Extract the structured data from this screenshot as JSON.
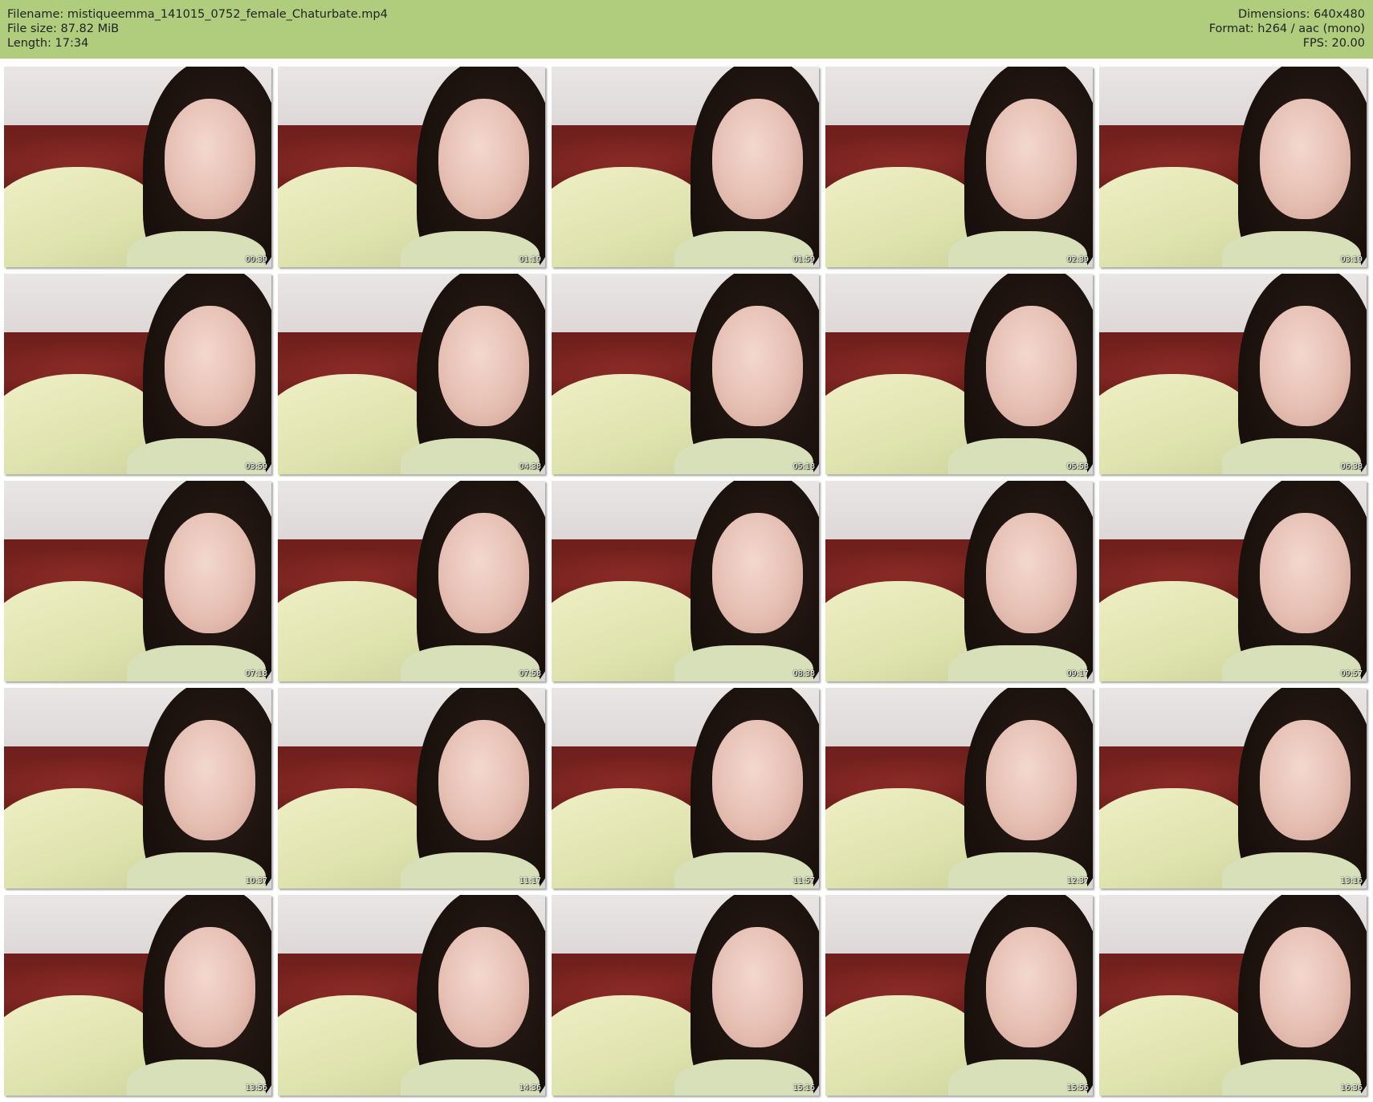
{
  "header": {
    "filename": "Filename: mistiqueemma_141015_0752_female_Chaturbate.mp4",
    "filesize": "File size: 87.82 MiB",
    "length": "Length: 17:34",
    "dimensions": "Dimensions: 640x480",
    "format": "Format: h264 / aac (mono)",
    "fps": "FPS: 20.00"
  },
  "colors": {
    "header_bg": "#b0cc7d",
    "page_bg": "#ffffff",
    "timestamp": "#ffffff"
  },
  "thumbnails": [
    "00:39",
    "01:19",
    "01:59",
    "02:39",
    "03:19",
    "03:59",
    "04:38",
    "05:18",
    "05:58",
    "06:38",
    "07:18",
    "07:58",
    "08:38",
    "09:17",
    "09:57",
    "10:37",
    "11:17",
    "11:57",
    "12:37",
    "13:16",
    "13:56",
    "14:36",
    "15:16",
    "15:56",
    "16:36"
  ]
}
